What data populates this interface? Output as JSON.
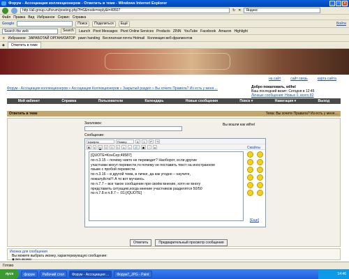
{
  "window": {
    "title": "Форум - Ассоциация коллекционеров - Ответить в теме - Windows Internet Explorer"
  },
  "address": {
    "url": "http://all-group.ru/forum/posting.php?f=6&mode=reply&t=49507",
    "search_placeholder": "Яндекс"
  },
  "menu": [
    "Файл",
    "Правка",
    "Вид",
    "Избранное",
    "Сервис",
    "Справка"
  ],
  "google": {
    "label": "Google",
    "search": "Поиск",
    "share": "Поделиться",
    "more": "Ещё",
    "login": "Войти"
  },
  "toolbar2": [
    "Search the web",
    "Search",
    "Launch",
    "Pivot Messages",
    "Pivot Online Services",
    "Products",
    "ZINN",
    "YouTube",
    "Facebook",
    "Amazon",
    "Highlight"
  ],
  "favorites": [
    "Избранное",
    "ЗАРАБОТАЙ ОРГАНИЗАТОР",
    "pawn handing",
    "Бесплатная почта Hotmail",
    "Коллекция веб-фрагментов"
  ],
  "tab": {
    "title": "Ответить в теме"
  },
  "toplinks": [
    "на сайт",
    "сайт связь",
    "карта сайта"
  ],
  "welcome": {
    "text": "Добро пожаловать, wilhel",
    "last_visit": "Ваш последний визит: Сегодня в 12:45",
    "messages": "Личные сообщения: Новых 0, всего 82"
  },
  "breadcrumb": "Форум - Ассоциация коллекционеров » Ассоциация Коллекционеров » Закрытый раздел » Вы хочите Правила? Из есть у меня....",
  "nav": [
    "Мой кабинет",
    "Справка",
    "Пользователи",
    "Календарь",
    "Новые сообщения",
    "Поиск ▾",
    "Навигация ▾",
    "Выход"
  ],
  "section": {
    "title": "Ответить в теме",
    "topic": "Тема: Вы хочите Правила? Из есть у меня...."
  },
  "form": {
    "title_label": "Заголовок:",
    "logged_as": "Вы вошли как wilhel",
    "message_label": "Сообщение:",
    "font_select": "Шрифты",
    "size_select": "Размер",
    "smilies_label": "Смайлы",
    "more_smilies": "[Еще]",
    "message": "[QUOTE=КонСер;49587]\nпо п.3.15 – почему никто не переведет? Наоборот, если другие\nучастники могут перевести,то почему не поставить текст на иностранном\nязыке с пробой перевести.\nпо п.3.16 – в другой тема, в личке, да как угодно – научите,\nпожалуйста!!! А то вот мучаюсь.\nпо п.7.7 – все такое сообщение при своём мнение, хотя не многу\nпредставить ситуацию,когда мнение участников разделятся 50/50\nпо п.7.8 и п.8.7 – :01:[/QUOTE]"
  },
  "icons": {
    "label": "Иконка для сообщения",
    "desc": "Вы можете выбрать иконку, характеризующую сообщение:",
    "none": "Без иконки"
  },
  "buttons": [
    "Ответить",
    "Предварительный просмотр сообщения"
  ],
  "status": {
    "text": "Готово"
  },
  "taskbar": {
    "start": "пуск",
    "tasks": [
      "форум",
      "Рабочий стол",
      "Форум - Ассоциация ...",
      "Форум7_JPG - Paint"
    ],
    "clock": "14:46"
  }
}
